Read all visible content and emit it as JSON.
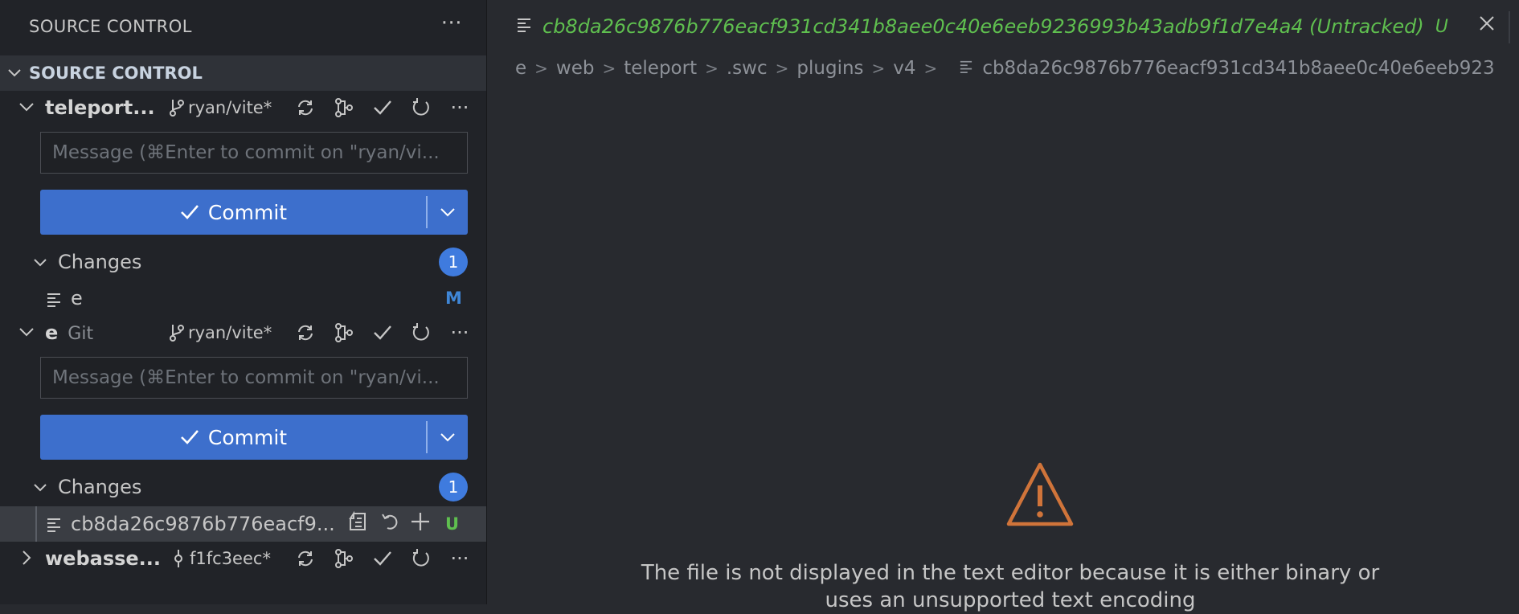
{
  "sidebar": {
    "title": "SOURCE CONTROL",
    "section_title": "SOURCE CONTROL",
    "repos": [
      {
        "name": "teleport...",
        "provider": "",
        "branch": "ryan/vite*",
        "message_placeholder": "Message (⌘Enter to commit on \"ryan/vi...",
        "commit_label": "Commit",
        "changes_label": "Changes",
        "changes_count": "1",
        "files": [
          {
            "name": "e",
            "status": "M"
          }
        ]
      },
      {
        "name": "e",
        "provider": "Git",
        "branch": "ryan/vite*",
        "message_placeholder": "Message (⌘Enter to commit on \"ryan/vi...",
        "commit_label": "Commit",
        "changes_label": "Changes",
        "changes_count": "1",
        "files": [
          {
            "name": "cb8da26c9876b776eacf9...",
            "status": "U"
          }
        ]
      },
      {
        "name": "webasse...",
        "provider": "",
        "branch": "f1fc3eec*"
      }
    ]
  },
  "editor": {
    "tab": {
      "title": "cb8da26c9876b776eacf931cd341b8aee0c40e6eeb9236993b43adb9f1d7e4a4 (Untracked)",
      "status": "U"
    },
    "breadcrumbs": [
      "e",
      "web",
      "teleport",
      ".swc",
      "plugins",
      "v4",
      "cb8da26c9876b776eacf931cd341b8aee0c40e6eeb923"
    ],
    "message_line1": "The file is not displayed in the text editor because it is either binary or",
    "message_line2": "uses an unsupported text encoding"
  },
  "colors": {
    "accent": "#3d6fcc",
    "badge": "#3f7bde",
    "untracked": "#5fbf4f",
    "modified": "#3f86d6",
    "warning": "#d0743a"
  }
}
